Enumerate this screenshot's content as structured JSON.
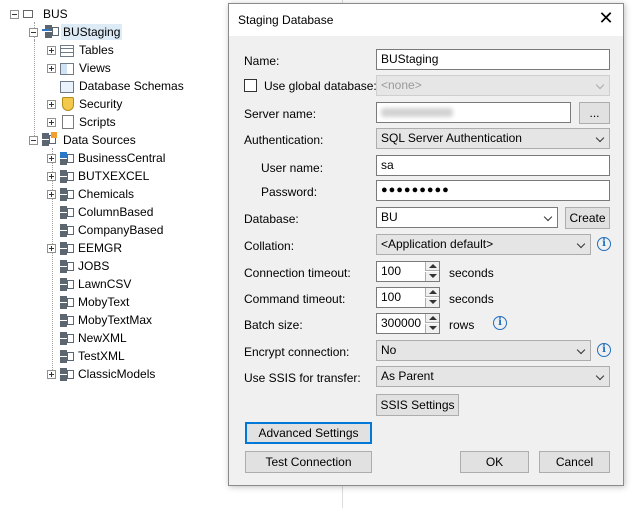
{
  "tree": {
    "root": "BUS",
    "project": "BUStaging",
    "project_children": [
      "Tables",
      "Views",
      "Database Schemas",
      "Security",
      "Scripts"
    ],
    "data_sources_label": "Data Sources",
    "data_sources": [
      "BusinessCentral",
      "BUTXEXCEL",
      "Chemicals",
      "ColumnBased",
      "CompanyBased",
      "EEMGR",
      "JOBS",
      "LawnCSV",
      "MobyText",
      "MobyTextMax",
      "NewXML",
      "TestXML",
      "ClassicModels"
    ]
  },
  "dialog": {
    "title": "Staging Database",
    "close_glyph": "✕",
    "name_label": "Name:",
    "name_value": "BUStaging",
    "use_global_label": "Use global database:",
    "global_db_value": "<none>",
    "server_label": "Server name:",
    "server_value": "",
    "browse_label": "...",
    "auth_label": "Authentication:",
    "auth_value": "SQL Server Authentication",
    "user_label": "User name:",
    "user_value": "sa",
    "password_label": "Password:",
    "password_value": "●●●●●●●●●",
    "database_label": "Database:",
    "database_value": "BU",
    "create_label": "Create",
    "collation_label": "Collation:",
    "collation_value": "<Application default>",
    "conn_timeout_label": "Connection timeout:",
    "conn_timeout_value": "100",
    "cmd_timeout_label": "Command timeout:",
    "cmd_timeout_value": "100",
    "seconds_unit": "seconds",
    "batch_label": "Batch size:",
    "batch_value": "300000",
    "rows_unit": "rows",
    "encrypt_label": "Encrypt connection:",
    "encrypt_value": "No",
    "ssis_label": "Use SSIS for transfer:",
    "ssis_value": "As Parent",
    "ssis_settings_label": "SSIS Settings",
    "advanced_label": "Advanced Settings",
    "test_label": "Test Connection",
    "ok_label": "OK",
    "cancel_label": "Cancel",
    "info_glyph": "i"
  }
}
